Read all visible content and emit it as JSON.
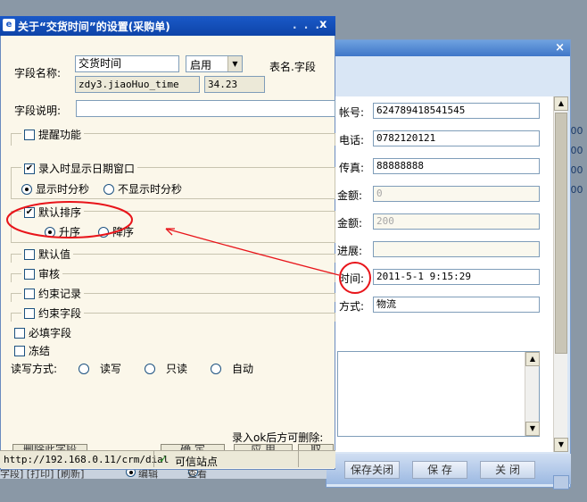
{
  "dialog": {
    "title": "关于“交货时间”的设置(采购单)",
    "title_dots": ". . .",
    "close_glyph": "x",
    "field_name_label": "字段名称:",
    "field_name_value": "交货时间",
    "status_select": "启用",
    "table_field_label": "表名.字段",
    "db_field_value": "zdy3.jiaoHuo_time",
    "width_value": "34.23",
    "desc_label": "字段说明:",
    "remind_label": "提醒功能",
    "show_date_label": "录入时显示日期窗口",
    "show_hm_label": "显示时分秒",
    "no_hm_label": "不显示时分秒",
    "default_sort_label": "默认排序",
    "asc_label": "升序",
    "desc_sort_label": "降序",
    "default_value_label": "默认值",
    "audit_label": "审核",
    "constraint_record_label": "约束记录",
    "constraint_field_label": "约束字段",
    "required_label": "必填字段",
    "freeze_label": "冻结",
    "rw_label": "读写方式:",
    "rw_options": [
      "读写",
      "只读",
      "自动"
    ],
    "delete_hint": "录入ok后方可删除:",
    "btn_delete_field": "删除此字段",
    "btn_ok": "确 定",
    "btn_apply": "应 用",
    "btn_cancel": "取"
  },
  "statusbar": {
    "url": "http://192.168.0.11/crm/dial",
    "trusted": "可信站点",
    "check_glyph": "✓"
  },
  "right": {
    "rows": [
      {
        "label": "帐号:",
        "value": "624789418541545",
        "disabled": false
      },
      {
        "label": "电话:",
        "value": "0782120121",
        "disabled": false
      },
      {
        "label": "传真:",
        "value": "88888888",
        "disabled": false
      },
      {
        "label": "金额:",
        "value": "0",
        "disabled": true
      },
      {
        "label": "金额:",
        "value": "200",
        "disabled": true
      },
      {
        "label": "进展:",
        "value": "",
        "disabled": true
      },
      {
        "label": "时间:",
        "value": "2011-5-1 9:15:29",
        "disabled": false
      },
      {
        "label": "方式:",
        "value": "物流",
        "disabled": false
      }
    ],
    "close_x": "×",
    "btn_save_close": "保存关闭",
    "btn_save": "保 存",
    "btn_close": "关 闭",
    "edge_values": [
      ".00",
      ".00",
      ".00",
      ".00"
    ],
    "bottom_strip": "字段] [打印] [刷新]",
    "bottom_edit": "编辑",
    "bottom_view": "查看"
  },
  "colors": {
    "annotation_red": "#e8141a",
    "title_blue": "#1a59c8",
    "dialog_bg": "#fbf7ea"
  }
}
